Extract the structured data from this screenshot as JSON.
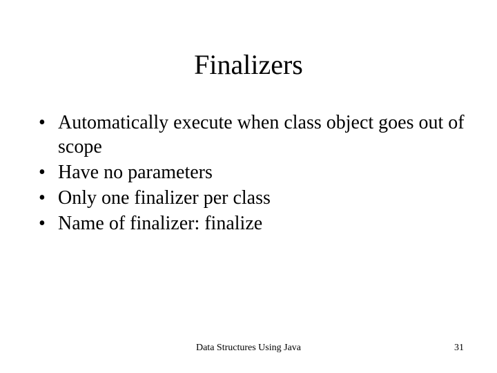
{
  "title": "Finalizers",
  "bullets": [
    "Automatically execute when class object goes out of scope",
    "Have no parameters",
    "Only one finalizer per class",
    "Name of finalizer: finalize"
  ],
  "footer": {
    "center": "Data Structures Using Java",
    "page": "31"
  }
}
